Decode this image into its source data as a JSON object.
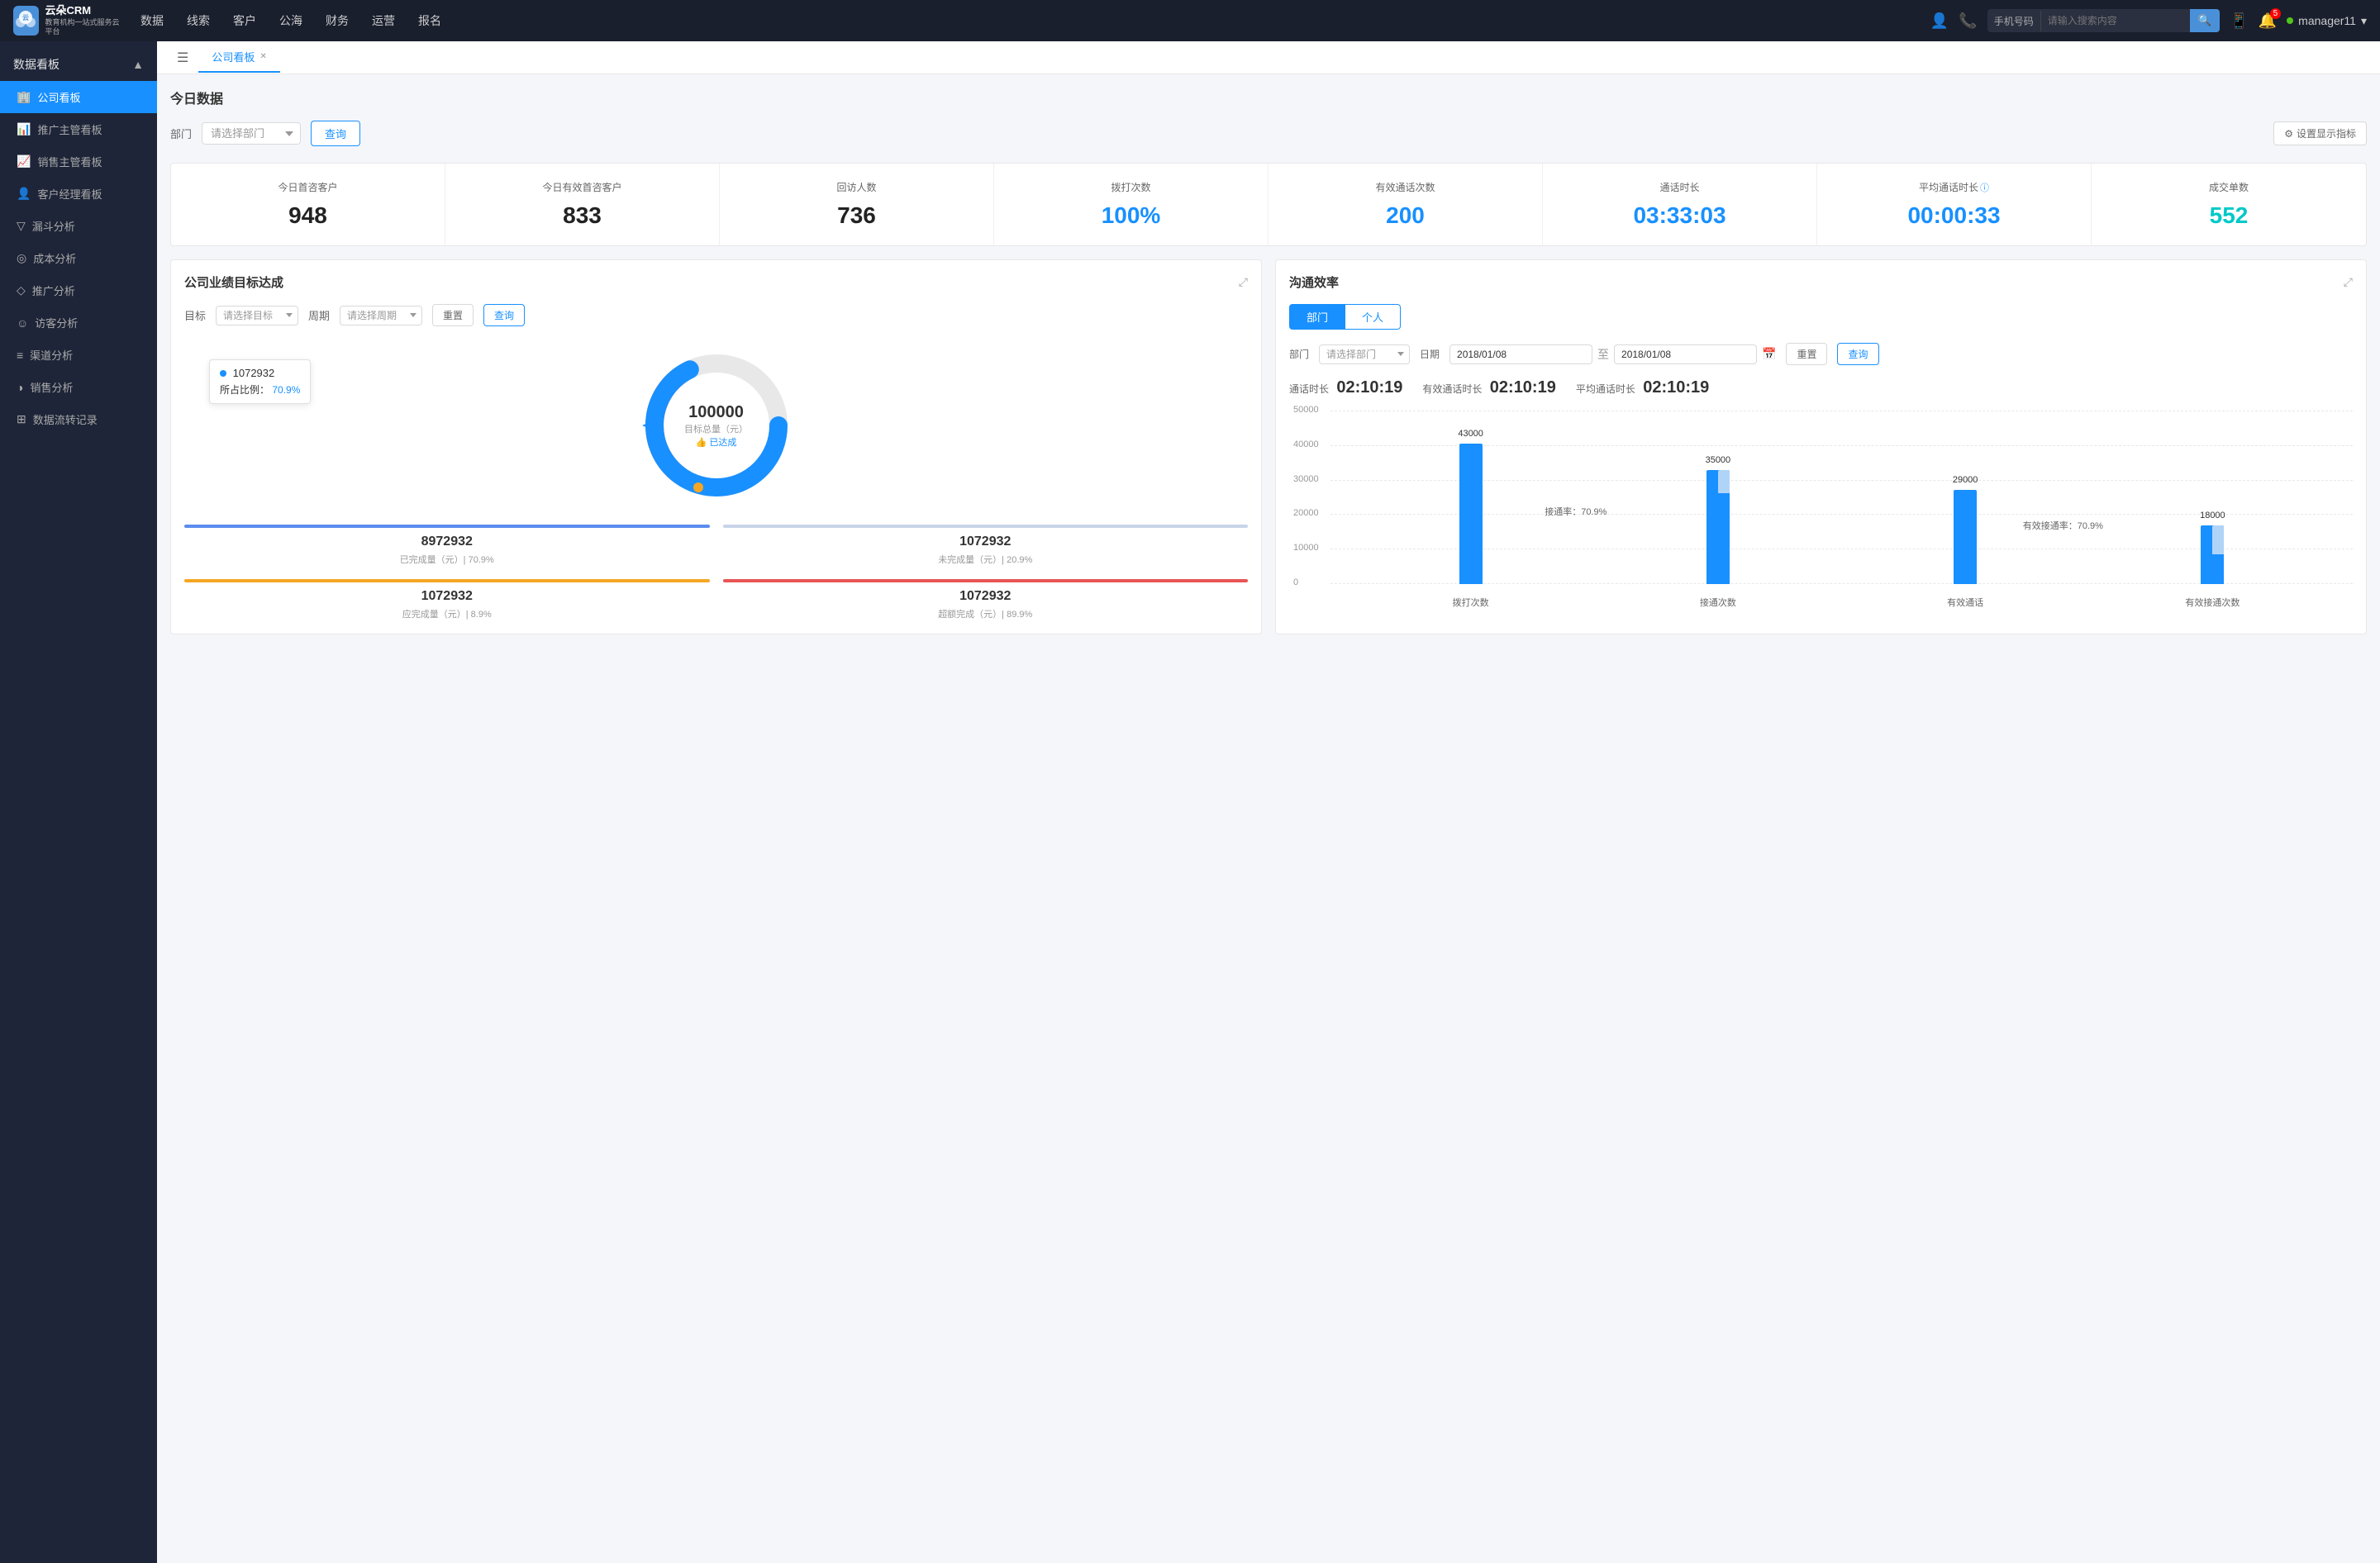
{
  "app": {
    "logo_line1": "云朵CRM",
    "logo_line2": "教育机构一站\n式服务云平台"
  },
  "top_nav": {
    "items": [
      "数据",
      "线索",
      "客户",
      "公海",
      "财务",
      "运营",
      "报名"
    ],
    "search_prefix": "手机号码",
    "search_placeholder": "请输入搜索内容",
    "notification_count": "5",
    "username": "manager11"
  },
  "sidebar": {
    "section_label": "数据看板",
    "items": [
      {
        "label": "公司看板",
        "icon": "🏢",
        "active": true
      },
      {
        "label": "推广主管看板",
        "icon": "📊",
        "active": false
      },
      {
        "label": "销售主管看板",
        "icon": "📈",
        "active": false
      },
      {
        "label": "客户经理看板",
        "icon": "👤",
        "active": false
      },
      {
        "label": "漏斗分析",
        "icon": "▽",
        "active": false
      },
      {
        "label": "成本分析",
        "icon": "◎",
        "active": false
      },
      {
        "label": "推广分析",
        "icon": "◇",
        "active": false
      },
      {
        "label": "访客分析",
        "icon": "☺",
        "active": false
      },
      {
        "label": "渠道分析",
        "icon": "≡",
        "active": false
      },
      {
        "label": "销售分析",
        "icon": "◑",
        "active": false
      },
      {
        "label": "数据流转记录",
        "icon": "⊞",
        "active": false
      }
    ]
  },
  "tabs": [
    {
      "label": "公司看板",
      "active": true
    }
  ],
  "today_data": {
    "title": "今日数据",
    "dept_label": "部门",
    "dept_placeholder": "请选择部门",
    "query_btn": "查询",
    "settings_btn": "设置显示指标",
    "stats": [
      {
        "label": "今日首咨客户",
        "value": "948",
        "color": "black"
      },
      {
        "label": "今日有效首咨客户",
        "value": "833",
        "color": "black"
      },
      {
        "label": "回访人数",
        "value": "736",
        "color": "black"
      },
      {
        "label": "拨打次数",
        "value": "100%",
        "color": "blue"
      },
      {
        "label": "有效通话次数",
        "value": "200",
        "color": "black"
      },
      {
        "label": "通话时长",
        "value": "03:33:03",
        "color": "blue"
      },
      {
        "label": "平均通话时长",
        "value": "00:00:33",
        "color": "blue"
      },
      {
        "label": "成交单数",
        "value": "552",
        "color": "cyan"
      }
    ]
  },
  "goal_panel": {
    "title": "公司业绩目标达成",
    "target_label": "目标",
    "target_placeholder": "请选择目标",
    "period_label": "周期",
    "period_placeholder": "请选择周期",
    "reset_btn": "重置",
    "query_btn": "查询",
    "donut": {
      "center_value": "100000",
      "center_label": "目标总量（元）",
      "center_badge": "👍 已达成",
      "tooltip_value": "1072932",
      "tooltip_label": "所占比例：",
      "tooltip_pct": "70.9%"
    },
    "stats": [
      {
        "bar_color": "#5b8cee",
        "value": "8972932",
        "label": "已完成量（元）| 70.9%"
      },
      {
        "bar_color": "#c8d4e8",
        "value": "1072932",
        "label": "未完成量（元）| 20.9%"
      },
      {
        "bar_color": "#f5a623",
        "value": "1072932",
        "label": "应完成量（元）| 8.9%"
      },
      {
        "bar_color": "#e85555",
        "value": "1072932",
        "label": "超额完成（元）| 89.9%"
      }
    ]
  },
  "comm_panel": {
    "title": "沟通效率",
    "tabs": [
      "部门",
      "个人"
    ],
    "dept_label": "部门",
    "dept_placeholder": "请选择部门",
    "date_label": "日期",
    "date_start": "2018/01/08",
    "date_end": "2018/01/08",
    "reset_btn": "重置",
    "query_btn": "查询",
    "stats_label1": "通话时长",
    "stats_val1": "02:10:19",
    "stats_label2": "有效通话时长",
    "stats_val2": "02:10:19",
    "stats_label3": "平均通话时长",
    "stats_val3": "02:10:19",
    "chart": {
      "y_labels": [
        "50000",
        "40000",
        "30000",
        "20000",
        "10000",
        "0"
      ],
      "x_labels": [
        "拨打次数",
        "接通次数",
        "有效通话",
        "有效接通次数"
      ],
      "bars": [
        {
          "label": "43000",
          "height": 86,
          "color": "#1890ff",
          "sub_height": 0,
          "annotation": ""
        },
        {
          "label": "35000",
          "height": 70,
          "color": "#1890ff",
          "sub_height": 14,
          "annotation": "接通率：70.9%"
        },
        {
          "label": "29000",
          "height": 58,
          "color": "#1890ff",
          "sub_height": 0,
          "annotation": ""
        },
        {
          "label": "18000",
          "height": 36,
          "color": "#1890ff",
          "sub_height": 18,
          "annotation": "有效接通率：70.9%"
        }
      ]
    }
  }
}
